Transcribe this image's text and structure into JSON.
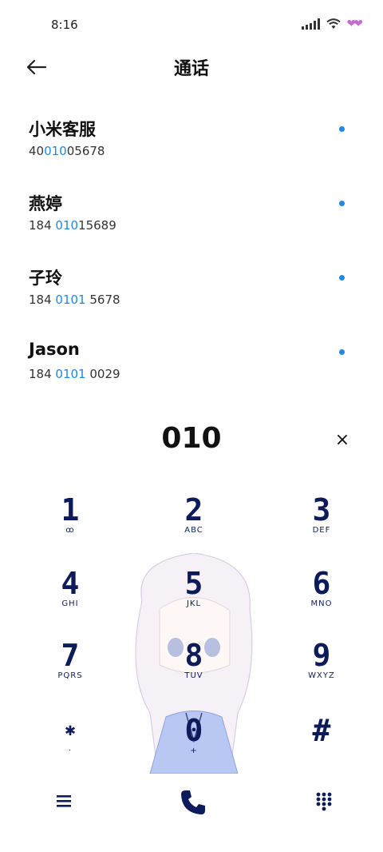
{
  "status_bar": {
    "time": "8:16"
  },
  "header": {
    "title": "通话"
  },
  "contacts": [
    {
      "name": "小米客服",
      "number_parts": [
        "40",
        "010",
        "05678"
      ]
    },
    {
      "name": "燕婷",
      "number_parts": [
        "184 ",
        "010",
        "15689"
      ]
    },
    {
      "name": "子玲",
      "number_parts": [
        "184 ",
        "0101",
        " 5678"
      ]
    },
    {
      "name": "Jason",
      "number_parts": [
        "184 ",
        "0101",
        " 0029"
      ]
    }
  ],
  "dialer": {
    "input": "010",
    "clear_label": "×"
  },
  "keypad": {
    "keys": [
      {
        "digit": "1",
        "letters": "ꝏ"
      },
      {
        "digit": "2",
        "letters": "ABC"
      },
      {
        "digit": "3",
        "letters": "DEF"
      },
      {
        "digit": "4",
        "letters": "GHI"
      },
      {
        "digit": "5",
        "letters": "JKL"
      },
      {
        "digit": "6",
        "letters": "MNO"
      },
      {
        "digit": "7",
        "letters": "PQRS"
      },
      {
        "digit": "8",
        "letters": "TUV"
      },
      {
        "digit": "9",
        "letters": "WXYZ"
      },
      {
        "digit": "✱",
        "letters": "·"
      },
      {
        "digit": "0",
        "letters": "+"
      },
      {
        "digit": "#",
        "letters": ""
      }
    ]
  },
  "colors": {
    "accent": "#1e88e5",
    "keypad_text": "#0d1b5a",
    "heart": "#c56bd1"
  },
  "icons": {
    "back": "arrow-left-icon",
    "menu": "menu-icon",
    "call": "phone-icon",
    "dialpad": "dialpad-icon",
    "clear": "close-icon"
  }
}
